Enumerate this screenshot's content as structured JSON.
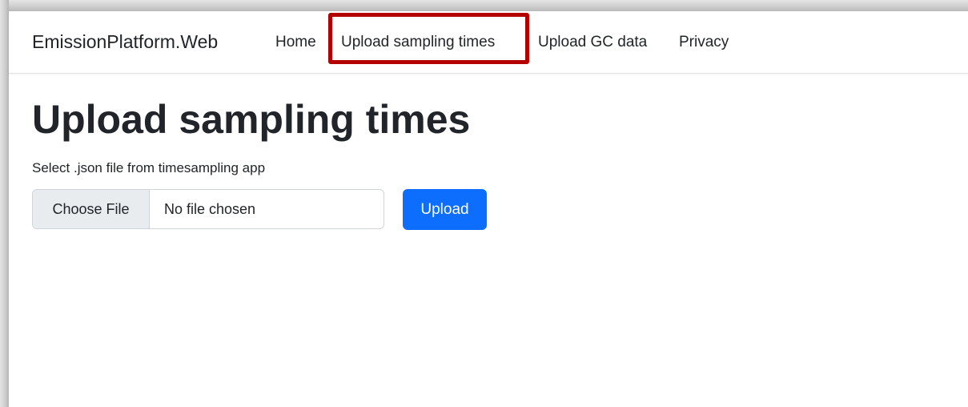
{
  "navbar": {
    "brand": "EmissionPlatform.Web",
    "links": [
      {
        "label": "Home"
      },
      {
        "label": "Upload sampling times",
        "highlighted": true
      },
      {
        "label": "Upload GC data"
      },
      {
        "label": "Privacy"
      }
    ]
  },
  "main": {
    "title": "Upload sampling times",
    "instruction": "Select .json file from timesampling app",
    "file_input": {
      "button_label": "Choose File",
      "status": "No file chosen"
    },
    "upload_button": "Upload"
  },
  "colors": {
    "highlight_border": "#b30000",
    "primary_button": "#0d6efd",
    "file_button_bg": "#e9ecef",
    "text": "#212529"
  }
}
